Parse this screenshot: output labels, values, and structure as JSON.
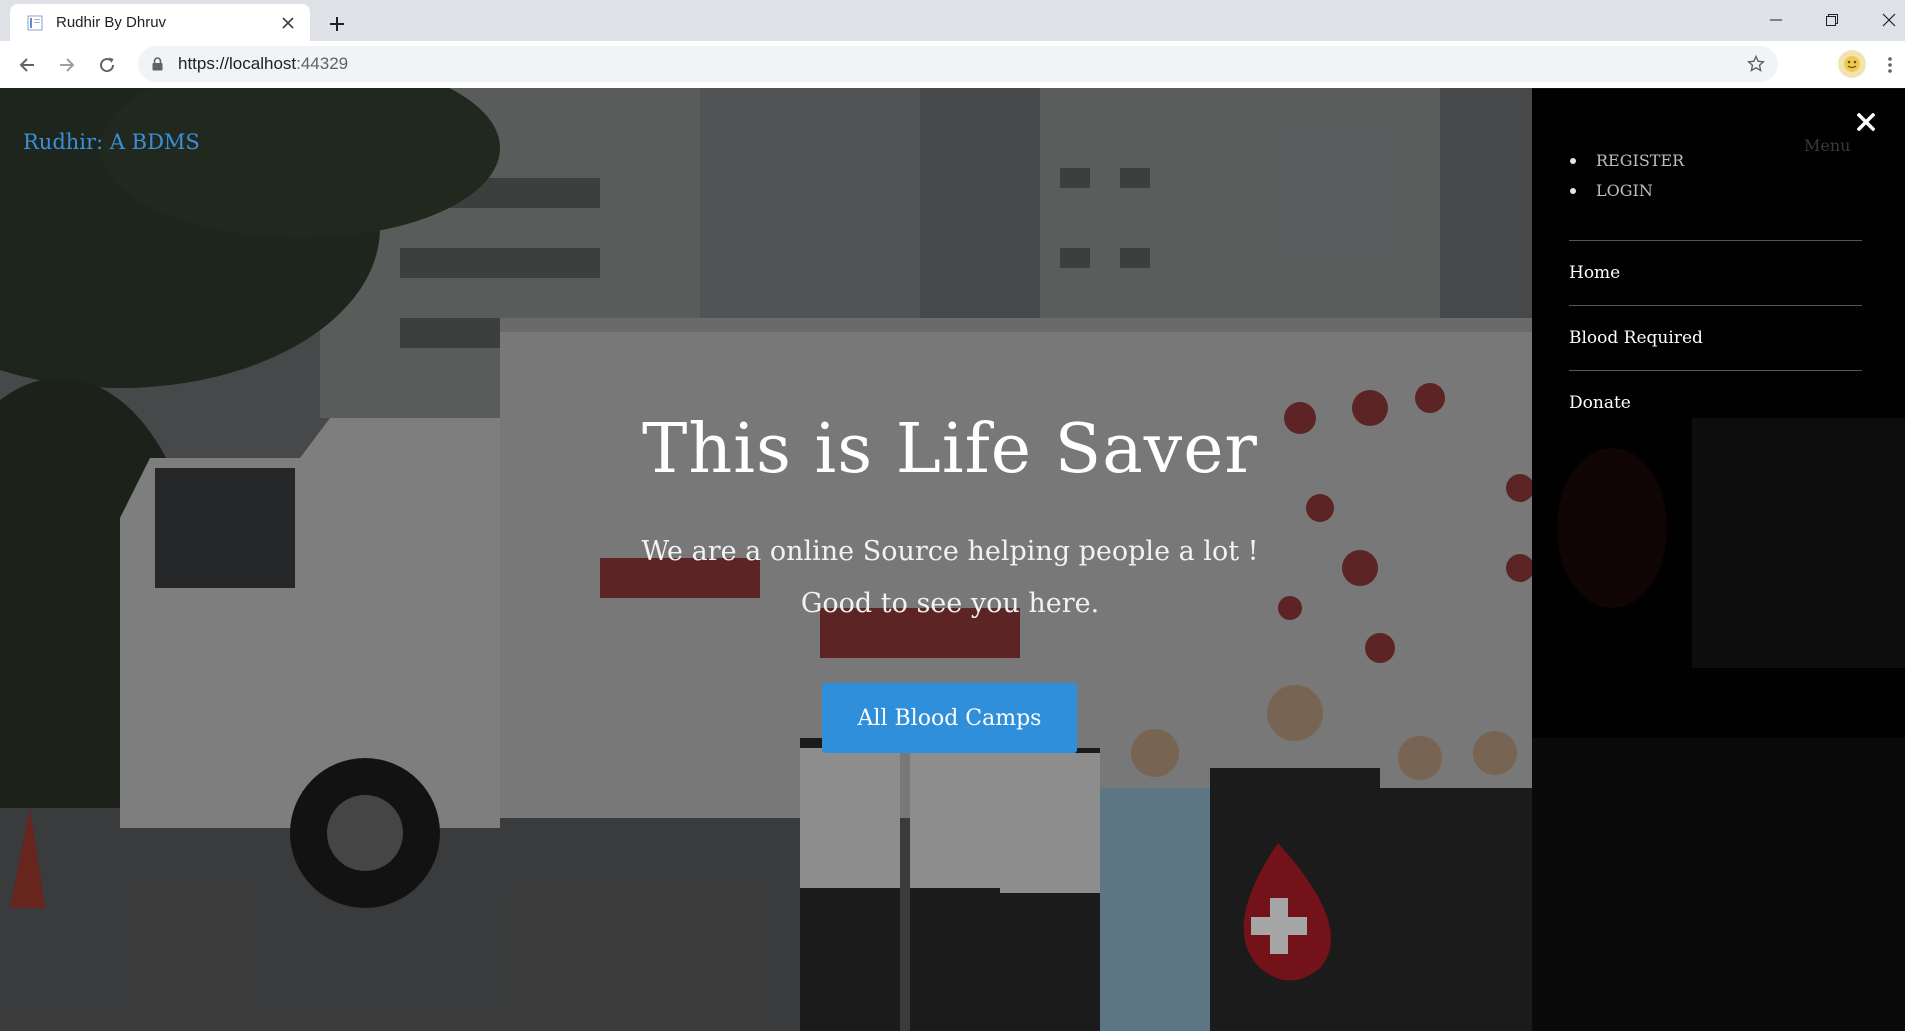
{
  "browser": {
    "tab_title": "Rudhir By Dhruv",
    "url_host": "https://localhost",
    "url_port": ":44329"
  },
  "page": {
    "brand": "Rudhir: A BDMS",
    "hero_title": "This is Life Saver",
    "hero_subtitle_1": "We are a online Source helping people a lot !",
    "hero_subtitle_2": "Good to see you here.",
    "cta_label": "All Blood Camps",
    "menu_toggle_label": "Menu"
  },
  "sidemenu": {
    "auth_items": [
      {
        "label": "REGISTER"
      },
      {
        "label": "LOGIN"
      }
    ],
    "links": [
      {
        "label": "Home"
      },
      {
        "label": "Blood Required"
      },
      {
        "label": "Donate"
      }
    ]
  },
  "colors": {
    "accent": "#2f8fdb",
    "brand_link": "#3b8fd9"
  },
  "icons": {
    "tab_close": "close-icon",
    "new_tab": "plus-icon",
    "back": "arrow-left-icon",
    "forward": "arrow-right-icon",
    "reload": "reload-icon",
    "secure": "lock-icon",
    "bookmark": "star-icon",
    "profile": "avatar-icon",
    "browser_menu": "kebab-icon",
    "menu_close": "close-icon"
  }
}
